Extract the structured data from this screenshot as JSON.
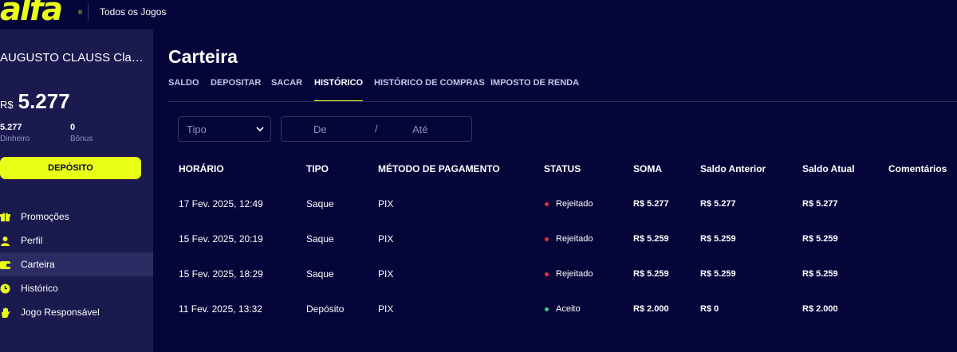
{
  "header": {
    "logo_text": "alfa",
    "logo_mark": "®",
    "nav_link": "Todos os Jogos"
  },
  "sidebar": {
    "user_name": "AUGUSTO CLAUSS Clau...",
    "currency": "R$",
    "balance": "5.277",
    "cash_value": "5.277",
    "cash_label": "Dinheiro",
    "bonus_value": "0",
    "bonus_label": "Bônus",
    "deposit_button": "DEPÓSITO",
    "menu": [
      {
        "label": "Promoções",
        "icon": "gift-icon",
        "active": false
      },
      {
        "label": "Perfil",
        "icon": "user-icon",
        "active": false
      },
      {
        "label": "Carteira",
        "icon": "wallet-icon",
        "active": true
      },
      {
        "label": "Histórico",
        "icon": "clock-icon",
        "active": false
      },
      {
        "label": "Jogo Responsável",
        "icon": "hand-icon",
        "active": false
      }
    ]
  },
  "main": {
    "title": "Carteira",
    "tabs": [
      {
        "label": "SALDO",
        "active": false
      },
      {
        "label": "DEPOSITAR",
        "active": false
      },
      {
        "label": "SACAR",
        "active": false
      },
      {
        "label": "HISTÓRICO",
        "active": true
      },
      {
        "label": "HISTÓRICO DE COMPRAS",
        "active": false
      },
      {
        "label": "IMPOSTO DE RENDA",
        "active": false
      }
    ],
    "filters": {
      "type_placeholder": "Tipo",
      "from_placeholder": "De",
      "separator": "/",
      "to_placeholder": "Até"
    },
    "table": {
      "headers": [
        "HORÁRIO",
        "TIPO",
        "MÉTODO DE PAGAMENTO",
        "STATUS",
        "SOMA",
        "Saldo Anterior",
        "Saldo Atual",
        "Comentários"
      ],
      "rows": [
        {
          "time": "17 Fev. 2025, 12:49",
          "type": "Saque",
          "method": "PIX",
          "status": "Rejeitado",
          "status_color": "#e0313b",
          "amount": "R$ 5.277",
          "prev": "R$ 5.277",
          "current": "R$ 5.277",
          "comment": ""
        },
        {
          "time": "15 Fev. 2025, 20:19",
          "type": "Saque",
          "method": "PIX",
          "status": "Rejeitado",
          "status_color": "#e0313b",
          "amount": "R$ 5.259",
          "prev": "R$ 5.259",
          "current": "R$ 5.259",
          "comment": ""
        },
        {
          "time": "15 Fev. 2025, 18:29",
          "type": "Saque",
          "method": "PIX",
          "status": "Rejeitado",
          "status_color": "#e0313b",
          "amount": "R$ 5.259",
          "prev": "R$ 5.259",
          "current": "R$ 5.259",
          "comment": ""
        },
        {
          "time": "11 Fev. 2025, 13:32",
          "type": "Depósito",
          "method": "PIX",
          "status": "Aceito",
          "status_color": "#2ed47a",
          "amount": "R$ 2.000",
          "prev": "R$ 0",
          "current": "R$ 2.000",
          "comment": ""
        }
      ]
    }
  },
  "colors": {
    "background": "#05053a",
    "sidebar": "#1b1a4e",
    "accent": "#eaff16"
  }
}
